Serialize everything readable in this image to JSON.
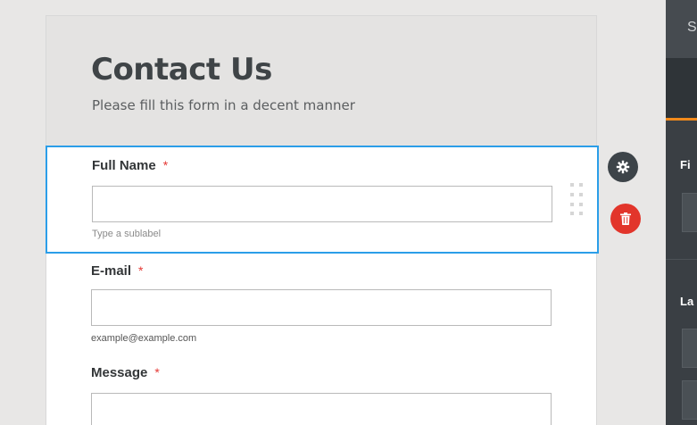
{
  "form": {
    "title": "Contact Us",
    "subtitle": "Please fill this form in a decent manner",
    "fields": [
      {
        "label": "Full Name",
        "required": "*",
        "value": "",
        "sublabel": "Type a sublabel"
      },
      {
        "label": "E-mail",
        "required": "*",
        "value": "",
        "sublabel": "example@example.com"
      },
      {
        "label": "Message",
        "required": "*",
        "value": ""
      }
    ]
  },
  "field_actions": {
    "settings_icon": "gear-icon",
    "delete_icon": "trash-icon"
  },
  "right_panel": {
    "top_text": "S",
    "label_1": "Fi",
    "label_2": "La"
  },
  "colors": {
    "selected_border": "#2b9ee8",
    "required": "#e53935",
    "delete_button": "#e2352b",
    "settings_button": "#3d4449",
    "panel_accent": "#f28a1b"
  }
}
